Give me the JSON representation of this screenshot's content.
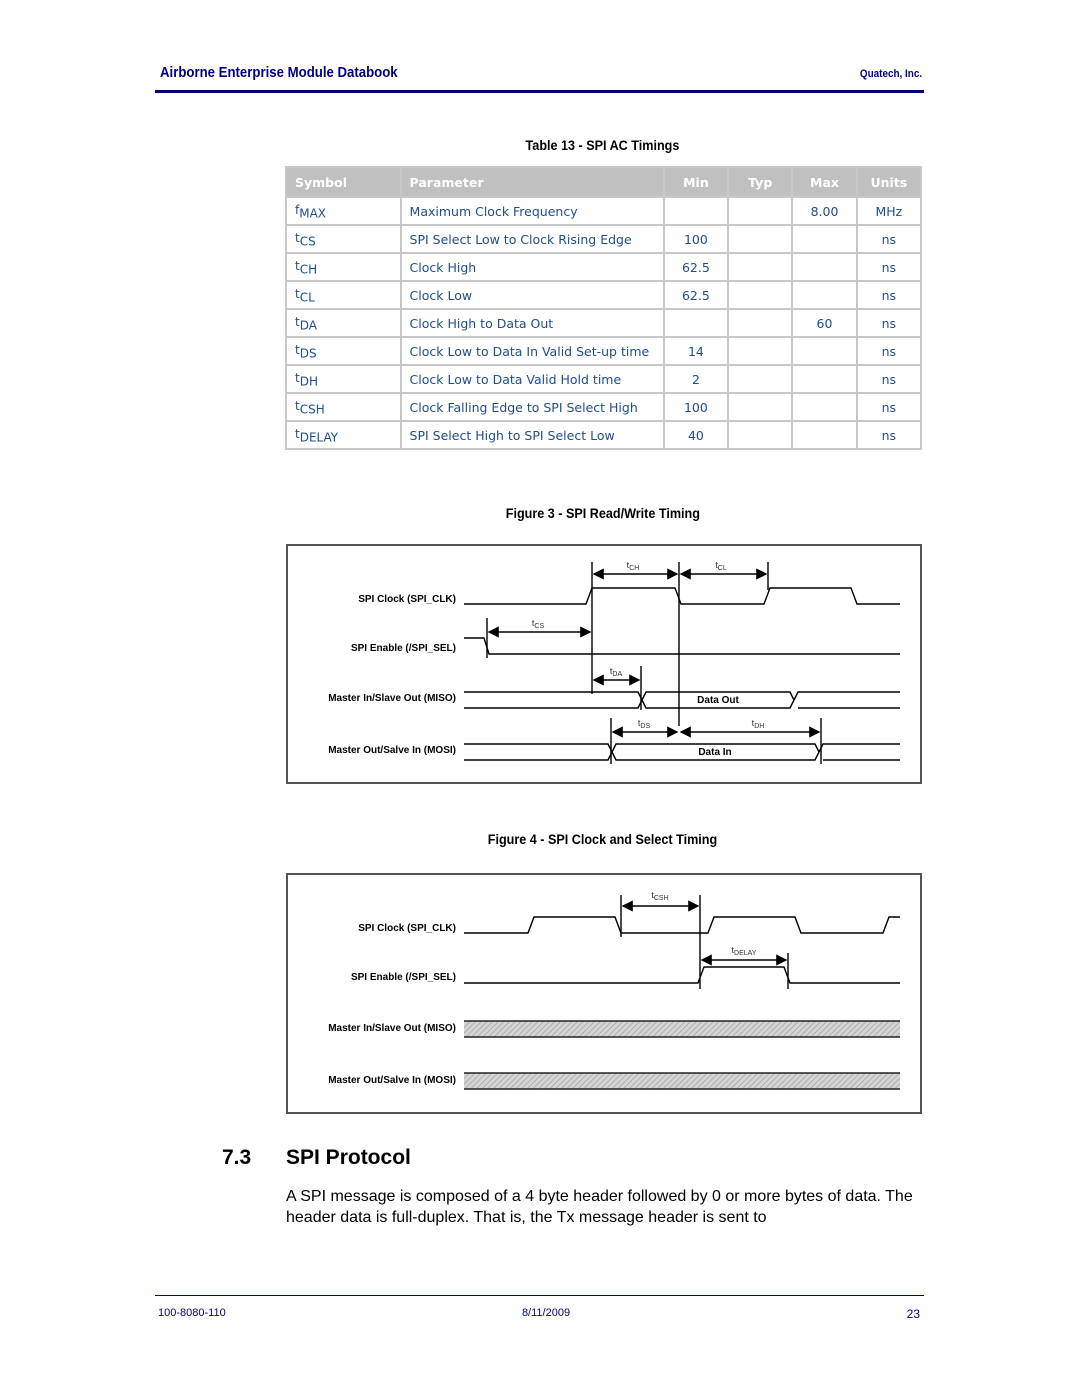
{
  "header": {
    "title": "Airborne Enterprise Module Databook",
    "company": "Quatech, Inc."
  },
  "table": {
    "caption": "Table 13 - SPI AC Timings",
    "columns": [
      "Symbol",
      "Parameter",
      "Min",
      "Typ",
      "Max",
      "Units"
    ],
    "rows": [
      {
        "sym": "f",
        "sub": "MAX",
        "param": "Maximum Clock Frequency",
        "min": "",
        "typ": "",
        "max": "8.00",
        "units": "MHz"
      },
      {
        "sym": "t",
        "sub": "CS",
        "param": "SPI Select Low to Clock Rising Edge",
        "min": "100",
        "typ": "",
        "max": "",
        "units": "ns"
      },
      {
        "sym": "t",
        "sub": "CH",
        "param": "Clock High",
        "min": "62.5",
        "typ": "",
        "max": "",
        "units": "ns"
      },
      {
        "sym": "t",
        "sub": "CL",
        "param": "Clock Low",
        "min": "62.5",
        "typ": "",
        "max": "",
        "units": "ns"
      },
      {
        "sym": "t",
        "sub": "DA",
        "param": "Clock High to Data Out",
        "min": "",
        "typ": "",
        "max": "60",
        "units": "ns"
      },
      {
        "sym": "t",
        "sub": "DS",
        "param": "Clock Low to Data In Valid Set-up time",
        "min": "14",
        "typ": "",
        "max": "",
        "units": "ns"
      },
      {
        "sym": "t",
        "sub": "DH",
        "param": "Clock Low to Data Valid Hold time",
        "min": "2",
        "typ": "",
        "max": "",
        "units": "ns"
      },
      {
        "sym": "t",
        "sub": "CSH",
        "param": "Clock Falling Edge to SPI Select High",
        "min": "100",
        "typ": "",
        "max": "",
        "units": "ns"
      },
      {
        "sym": "t",
        "sub": "DELAY",
        "param": "SPI Select High to SPI Select Low",
        "min": "40",
        "typ": "",
        "max": "",
        "units": "ns"
      }
    ]
  },
  "figure3": {
    "caption": "Figure 3 - SPI Read/Write Timing",
    "signals": [
      "SPI Clock (SPI_CLK)",
      "SPI Enable (/SPI_SEL)",
      "Master In/Slave Out (MISO)",
      "Master Out/Salve In (MOSI)"
    ],
    "labels": {
      "tch": "CH",
      "tcl": "CL",
      "tcs": "CS",
      "tda": "DA",
      "tds": "DS",
      "tdh": "DH",
      "data_out": "Data Out",
      "data_in": "Data In"
    }
  },
  "figure4": {
    "caption": "Figure 4 - SPI Clock and Select Timing",
    "signals": [
      "SPI Clock (SPI_CLK)",
      "SPI Enable (/SPI_SEL)",
      "Master In/Slave Out (MISO)",
      "Master Out/Salve In (MOSI)"
    ],
    "labels": {
      "tcsh": "CSH",
      "tdelay": "DELAY"
    }
  },
  "section": {
    "number": "7.3",
    "title": "SPI Protocol",
    "body": "A SPI message is composed of a 4 byte header followed by 0 or more bytes of data.  The header data is full-duplex.  That is, the Tx message header is sent to"
  },
  "footer": {
    "doc_number": "100-8080-110",
    "date": "8/11/2009",
    "page": "23"
  }
}
